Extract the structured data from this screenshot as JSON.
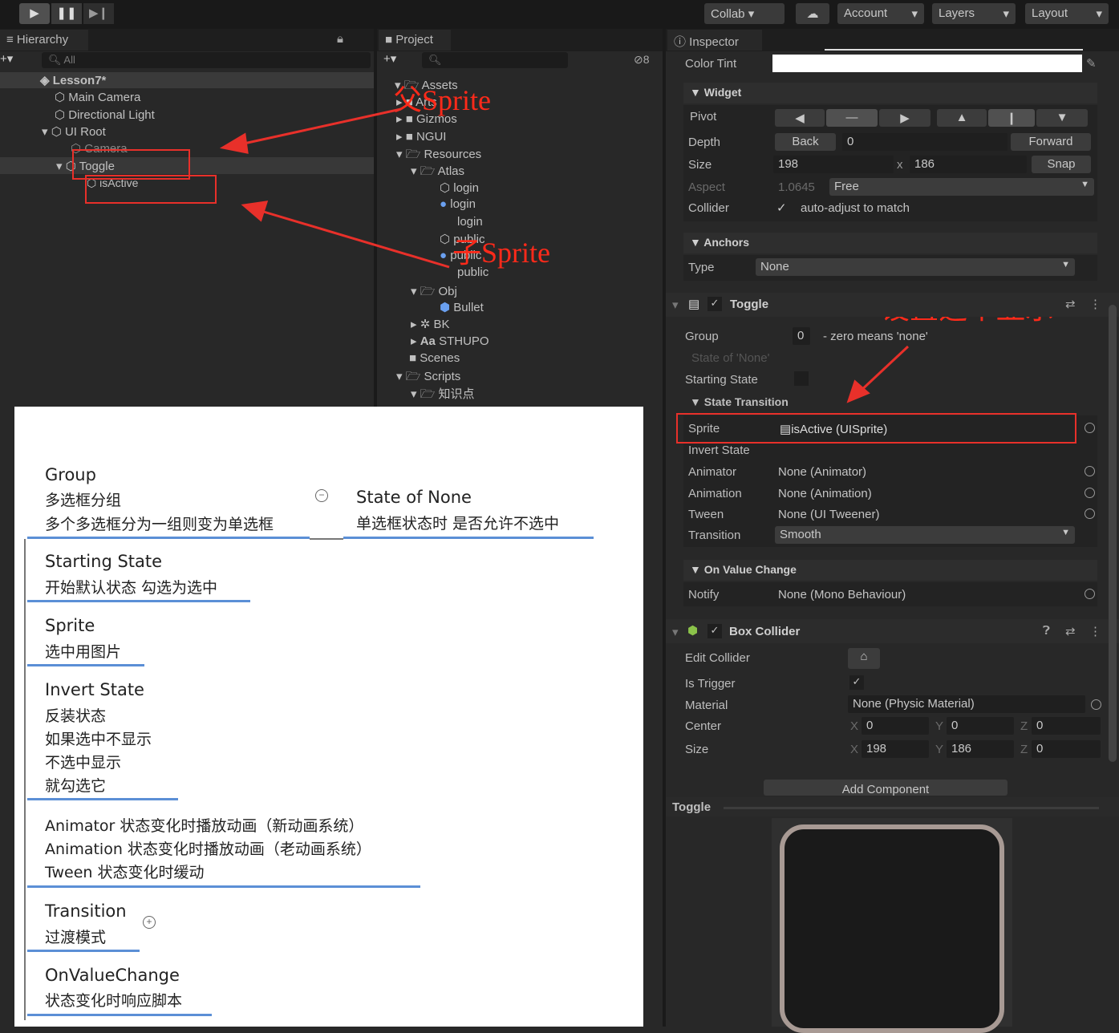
{
  "toolbar": {
    "collab": "Collab ▾",
    "account": "Account",
    "layers": "Layers",
    "layout": "Layout"
  },
  "hierarchy": {
    "title": "Hierarchy",
    "search_placeholder": "All",
    "scene": "Lesson7*",
    "items": [
      "Main Camera",
      "Directional Light",
      "UI Root",
      "Camera",
      "Toggle",
      "isActive"
    ]
  },
  "project": {
    "title": "Project",
    "hidden_count": "8",
    "items": [
      "Assets",
      "Arts",
      "Gizmos",
      "NGUI",
      "Resources",
      "Atlas",
      "login",
      "login",
      "login",
      "public",
      "public",
      "public",
      "Obj",
      "Bullet",
      "BK",
      "STHUPO",
      "Scenes",
      "Scripts",
      "知识点"
    ]
  },
  "annotations": {
    "parent_sprite": "父Sprite",
    "child_sprite": "子Sprite",
    "set_checked": "设置选中显示"
  },
  "inspector": {
    "title": "Inspector",
    "color_tint": "Color Tint",
    "color_tint_value": "#ffffff",
    "widget": {
      "title": "Widget",
      "pivot": "Pivot",
      "depth": "Depth",
      "back": "Back",
      "depth_value": "0",
      "forward": "Forward",
      "size": "Size",
      "w": "198",
      "x": "x",
      "h": "186",
      "snap": "Snap",
      "aspect": "Aspect",
      "aspect_value": "1.0645",
      "aspect_mode": "Free",
      "collider": "Collider",
      "collider_text": "auto-adjust to match"
    },
    "anchors": {
      "title": "Anchors",
      "type": "Type",
      "type_value": "None"
    },
    "toggle": {
      "title": "Toggle",
      "group": "Group",
      "group_value": "0",
      "group_hint": "- zero means 'none'",
      "state_of_none": "State of 'None'",
      "starting_state": "Starting State",
      "state_transition": "State Transition",
      "sprite": "Sprite",
      "sprite_value": "isActive (UISprite)",
      "invert_state": "Invert State",
      "animator": "Animator",
      "animator_value": "None (Animator)",
      "animation": "Animation",
      "animation_value": "None (Animation)",
      "tween": "Tween",
      "tween_value": "None (UI Tweener)",
      "transition": "Transition",
      "transition_value": "Smooth",
      "on_value_change": "On Value Change",
      "notify": "Notify",
      "notify_value": "None (Mono Behaviour)"
    },
    "box_collider": {
      "title": "Box Collider",
      "edit_collider": "Edit Collider",
      "is_trigger": "Is Trigger",
      "material": "Material",
      "material_value": "None (Physic Material)",
      "center": "Center",
      "size": "Size",
      "cx": "0",
      "cy": "0",
      "cz": "0",
      "sx": "198",
      "sy": "186",
      "sz": "0",
      "X": "X",
      "Y": "Y",
      "Z": "Z"
    },
    "add_component": "Add Component",
    "preview_title": "Toggle"
  },
  "mindmap": {
    "group_title": "Group",
    "group_l1": "多选框分组",
    "group_l2": "多个多选框分为一组则变为单选框",
    "son_title": "State of None",
    "son_l1": "单选框状态时 是否允许不选中",
    "ss_title": "Starting State",
    "ss_l1": "开始默认状态 勾选为选中",
    "sp_title": "Sprite",
    "sp_l1": "选中用图片",
    "is_title": "Invert State",
    "is_l1": "反装状态",
    "is_l2": "如果选中不显示",
    "is_l3": "不选中显示",
    "is_l4": "就勾选它",
    "anim_l1": "Animator  状态变化时播放动画（新动画系统）",
    "anim_l2": "Animation  状态变化时播放动画（老动画系统）",
    "anim_l3": "Tween  状态变化时缓动",
    "tr_title": "Transition",
    "tr_l1": "过渡模式",
    "ov_title": "OnValueChange",
    "ov_l1": "状态变化时响应脚本"
  }
}
